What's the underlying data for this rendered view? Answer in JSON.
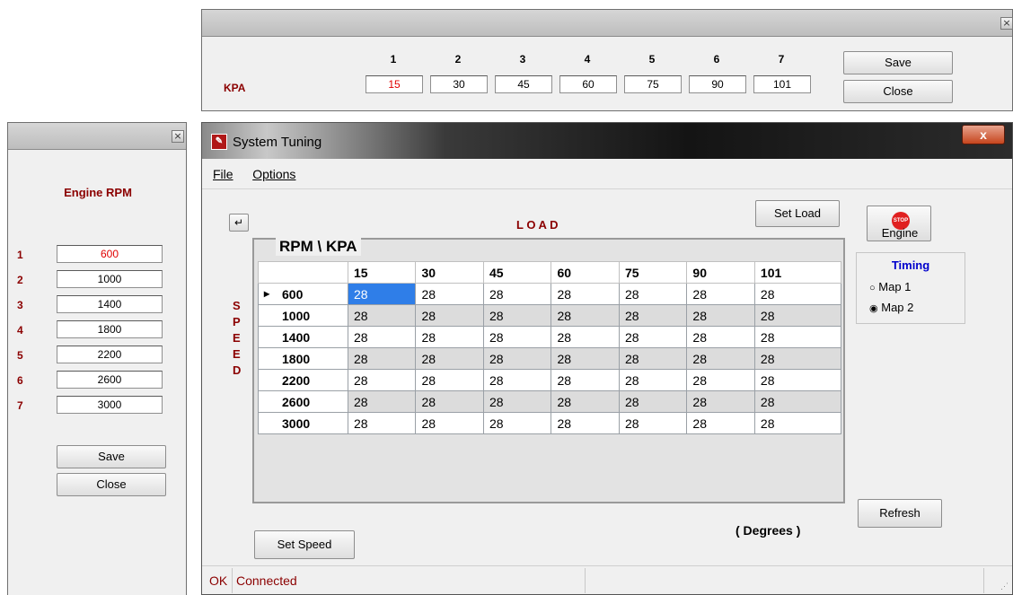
{
  "kpa_window": {
    "row_label": "KPA",
    "headers": [
      "1",
      "2",
      "3",
      "4",
      "5",
      "6",
      "7"
    ],
    "values": [
      "15",
      "30",
      "45",
      "60",
      "75",
      "90",
      "101"
    ],
    "save_label": "Save",
    "close_label": "Close",
    "close_icon": "×"
  },
  "rpm_window": {
    "title": "Engine RPM",
    "indices": [
      "1",
      "2",
      "3",
      "4",
      "5",
      "6",
      "7"
    ],
    "values": [
      "600",
      "1000",
      "1400",
      "1800",
      "2200",
      "2600",
      "3000"
    ],
    "save_label": "Save",
    "close_label": "Close",
    "close_icon": "×"
  },
  "main": {
    "title": "System Tuning",
    "close_icon": "x",
    "menu": [
      "File",
      "Options"
    ],
    "load_label": "L O A D",
    "set_load_label": "Set Load",
    "speed_letters": [
      "S",
      "P",
      "E",
      "E",
      "D"
    ],
    "grid_caption": "RPM \\ KPA",
    "engine_label": "Engine",
    "stop_label": "STOP",
    "timing": {
      "title": "Timing",
      "options": [
        "Map 1",
        "Map 2"
      ],
      "selected": "Map 2"
    },
    "refresh_label": "Refresh",
    "degrees_label": "( Degrees )",
    "set_speed_label": "Set Speed",
    "status": {
      "ok": "OK",
      "connection": "Connected"
    }
  },
  "grid": {
    "columns": [
      "15",
      "30",
      "45",
      "60",
      "75",
      "90",
      "101"
    ],
    "rows": [
      {
        "rpm": "600",
        "values": [
          "28",
          "28",
          "28",
          "28",
          "28",
          "28",
          "28"
        ]
      },
      {
        "rpm": "1000",
        "values": [
          "28",
          "28",
          "28",
          "28",
          "28",
          "28",
          "28"
        ]
      },
      {
        "rpm": "1400",
        "values": [
          "28",
          "28",
          "28",
          "28",
          "28",
          "28",
          "28"
        ]
      },
      {
        "rpm": "1800",
        "values": [
          "28",
          "28",
          "28",
          "28",
          "28",
          "28",
          "28"
        ]
      },
      {
        "rpm": "2200",
        "values": [
          "28",
          "28",
          "28",
          "28",
          "28",
          "28",
          "28"
        ]
      },
      {
        "rpm": "2600",
        "values": [
          "28",
          "28",
          "28",
          "28",
          "28",
          "28",
          "28"
        ]
      },
      {
        "rpm": "3000",
        "values": [
          "28",
          "28",
          "28",
          "28",
          "28",
          "28",
          "28"
        ]
      }
    ]
  },
  "colors": {
    "label_red": "#8b0000",
    "value_red": "#e00000",
    "timing_blue": "#0000cc",
    "selection_blue": "#2f7ee8",
    "row_alt": "#dcdcdc"
  }
}
